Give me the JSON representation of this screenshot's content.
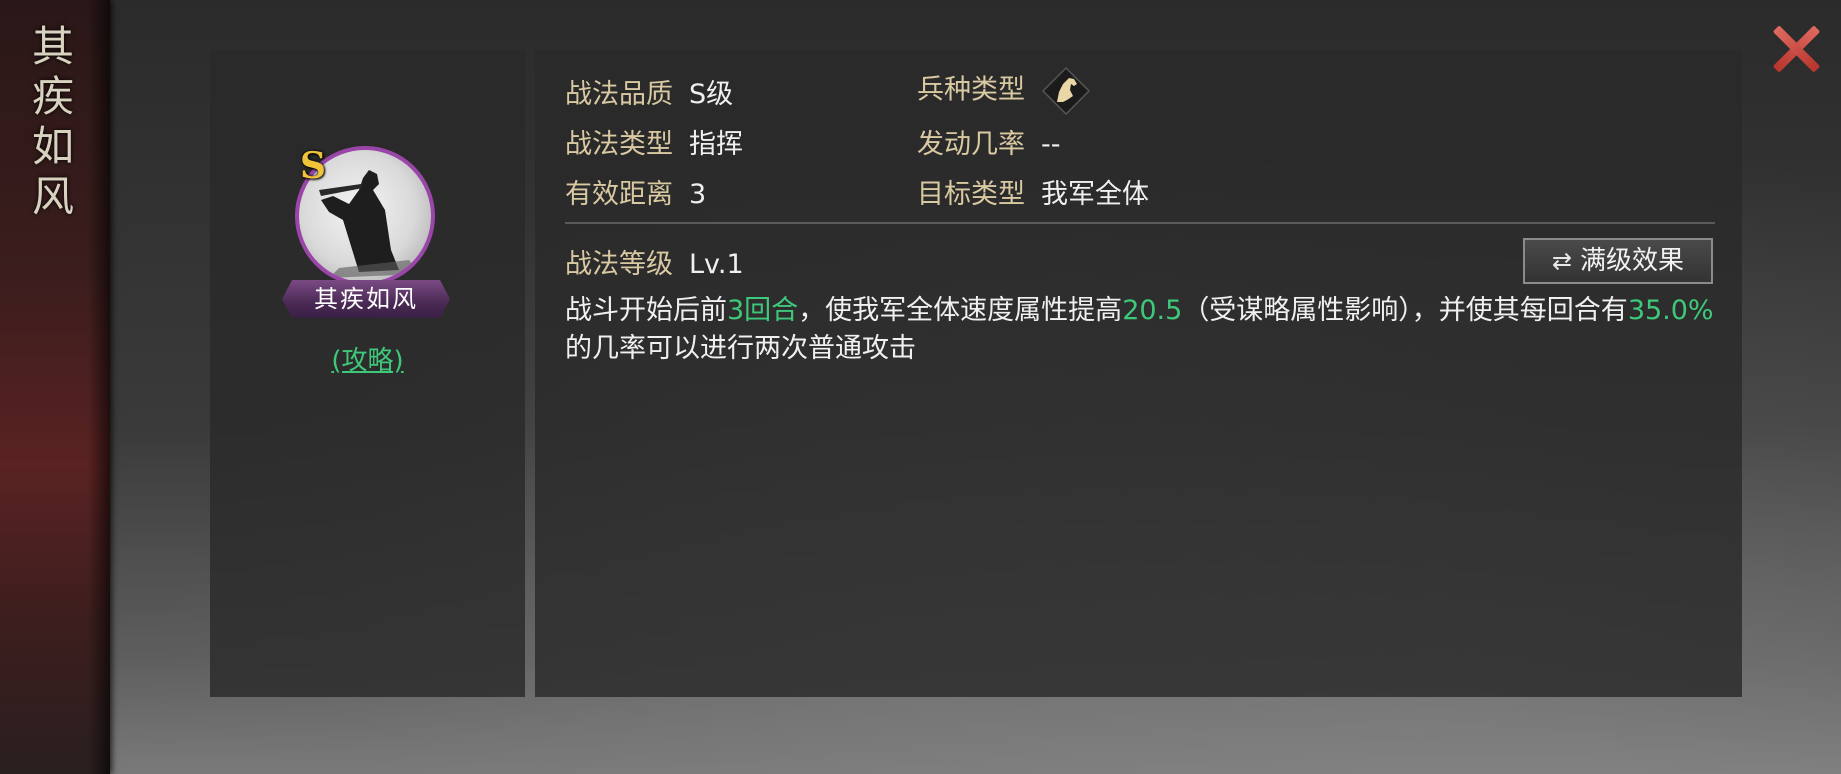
{
  "sidebar": {
    "title_chars": [
      "其",
      "疾",
      "如",
      "风"
    ]
  },
  "skill": {
    "grade_badge": "S",
    "name": "其疾如风",
    "strategy_link": "(攻略)",
    "icon": "warrior-silhouette-icon"
  },
  "info": {
    "quality_label": "战法品质",
    "quality_value": "S级",
    "type_label": "战法类型",
    "type_value": "指挥",
    "range_label": "有效距离",
    "range_value": "3",
    "troop_label": "兵种类型",
    "troop_icon": "cavalry-horse-icon",
    "trigger_label": "发动几率",
    "trigger_value": "--",
    "target_label": "目标类型",
    "target_value": "我军全体",
    "level_label": "战法等级",
    "level_value": "Lv.1",
    "max_effect_button": "满级效果",
    "max_effect_icon": "swap-arrows-icon"
  },
  "description": {
    "p1": "战斗开始后前",
    "h1": "3回合",
    "p2": "，使我军全体速度属性提高",
    "h2": "20.5",
    "p3": "（受谋略属性影响），并使其每回合有",
    "h3": "35.0%",
    "p4": "的几率可以进行两次普通攻击"
  },
  "colors": {
    "highlight": "#3ec97a",
    "label": "#d9c9a2",
    "grade": "#f0c33a",
    "frame": "#9a46a8",
    "close": "#c8443a"
  }
}
